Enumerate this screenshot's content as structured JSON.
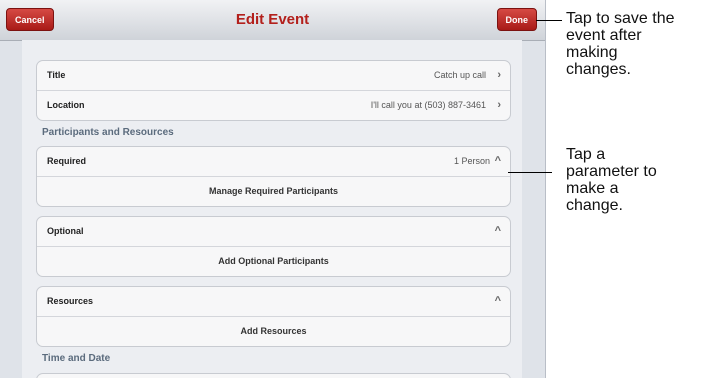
{
  "navbar": {
    "cancel_label": "Cancel",
    "title": "Edit Event",
    "done_label": "Done"
  },
  "event": {
    "title_label": "Title",
    "title_value": "Catch up call",
    "location_label": "Location",
    "location_value": "I'll call you at (503) 887-3461"
  },
  "sections": {
    "participants_header": "Participants and Resources",
    "time_header": "Time and Date"
  },
  "required": {
    "label": "Required",
    "value": "1 Person",
    "action": "Manage Required Participants"
  },
  "optional": {
    "label": "Optional",
    "action": "Add Optional Participants"
  },
  "resources": {
    "label": "Resources",
    "action": "Add Resources"
  },
  "icons": {
    "chevron_right": "›",
    "chevron_up": "^"
  },
  "callouts": {
    "done_line1": "Tap to save the",
    "done_line2": "event after",
    "done_line3": "making",
    "done_line4": "changes.",
    "param_line1": "Tap a",
    "param_line2": "parameter to",
    "param_line3": "make a",
    "param_line4": "change."
  }
}
